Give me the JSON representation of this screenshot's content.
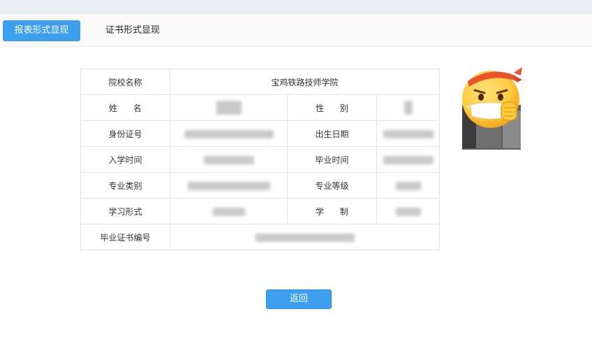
{
  "tabs": [
    {
      "label": "报表形式显现",
      "active": true
    },
    {
      "label": "证书形式显现",
      "active": false
    }
  ],
  "table": {
    "school_label": "院校名称",
    "school_value": "宝鸡铁路技师学院",
    "name_label": "姓      名",
    "gender_label": "性      别",
    "id_label": "身份证号",
    "birth_label": "出生日期",
    "enroll_label": "入学时间",
    "graduate_label": "毕业时间",
    "major_label": "专业类别",
    "level_label": "专业等级",
    "mode_label": "学习形式",
    "duration_label": "学      制",
    "cert_no_label": "毕业证书编号"
  },
  "back_button": "返回",
  "colors": {
    "accent": "#3d9ff0",
    "border": "#e3e3e3",
    "topbar": "#e9eef2"
  },
  "icons": {
    "avatar": "emoji-mask-avatar"
  }
}
